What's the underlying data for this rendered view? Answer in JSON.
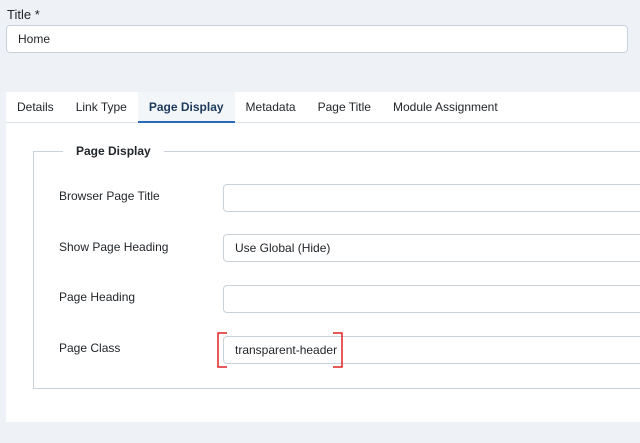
{
  "title_field": {
    "label": "Title *",
    "value": "Home"
  },
  "tabs": [
    {
      "label": "Details",
      "active": false
    },
    {
      "label": "Link Type",
      "active": false
    },
    {
      "label": "Page Display",
      "active": true
    },
    {
      "label": "Metadata",
      "active": false
    },
    {
      "label": "Page Title",
      "active": false
    },
    {
      "label": "Module Assignment",
      "active": false
    }
  ],
  "page_display": {
    "legend": "Page Display",
    "browser_page_title": {
      "label": "Browser Page Title",
      "value": ""
    },
    "show_page_heading": {
      "label": "Show Page Heading",
      "selected": "Use Global (Hide)"
    },
    "page_heading": {
      "label": "Page Heading",
      "value": ""
    },
    "page_class": {
      "label": "Page Class",
      "value": "transparent-header"
    }
  },
  "colors": {
    "background": "#eef2f7",
    "active_tab_underline": "#2a69b8",
    "annotation": "#e02424",
    "border": "#c9d2dc"
  }
}
